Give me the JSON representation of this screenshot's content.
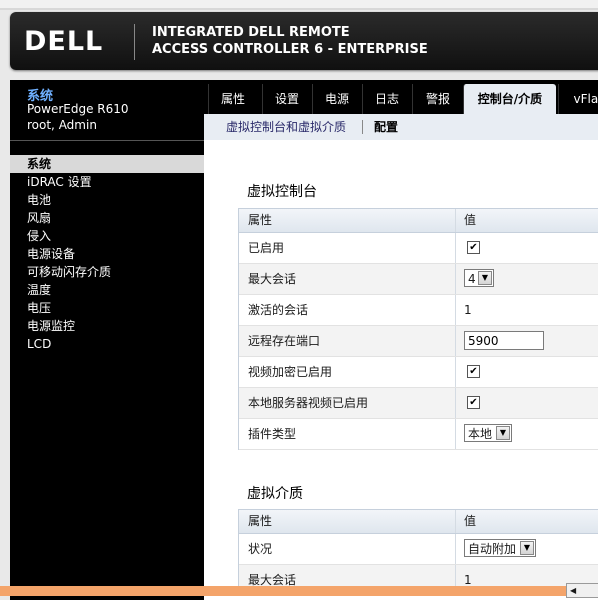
{
  "header": {
    "logo": "DELL",
    "title_line1": "INTEGRATED DELL REMOTE",
    "title_line2": "ACCESS CONTROLLER 6 - ENTERPRISE"
  },
  "sidebar": {
    "title": "系统",
    "model": "PowerEdge R610",
    "user": "root, Admin",
    "items": [
      {
        "label": "系统",
        "active": true
      },
      {
        "label": "iDRAC 设置"
      },
      {
        "label": "电池"
      },
      {
        "label": "风扇"
      },
      {
        "label": "侵入"
      },
      {
        "label": "电源设备"
      },
      {
        "label": "可移动闪存介质"
      },
      {
        "label": "温度"
      },
      {
        "label": "电压"
      },
      {
        "label": "电源监控"
      },
      {
        "label": "LCD"
      }
    ]
  },
  "tabs": [
    "属性",
    "设置",
    "电源",
    "日志",
    "警报",
    "控制台/介质",
    "vFlas"
  ],
  "subnav": {
    "link1": "虚拟控制台和虚拟介质",
    "link2": "配置"
  },
  "virtual_console": {
    "title": "虚拟控制台",
    "col_property": "属性",
    "col_value": "值",
    "rows": {
      "enabled": {
        "label": "已启用",
        "checked": true
      },
      "max_sessions": {
        "label": "最大会话",
        "value": "4"
      },
      "active_sessions": {
        "label": "激活的会话",
        "value": "1"
      },
      "remote_port": {
        "label": "远程存在端口",
        "value": "5900"
      },
      "video_encryption": {
        "label": "视频加密已启用",
        "checked": true
      },
      "local_video": {
        "label": "本地服务器视频已启用",
        "checked": true
      },
      "plugin_type": {
        "label": "插件类型",
        "value": "本地"
      }
    }
  },
  "virtual_media": {
    "title": "虚拟介质",
    "col_property": "属性",
    "col_value": "值",
    "rows": {
      "status": {
        "label": "状况",
        "value": "自动附加"
      },
      "max_sessions": {
        "label": "最大会话",
        "value": "1"
      }
    }
  },
  "colors": {
    "sidebar_bg": "#000000",
    "accent_blue": "#6fb0ff",
    "active_tab": "#e8edf3"
  }
}
